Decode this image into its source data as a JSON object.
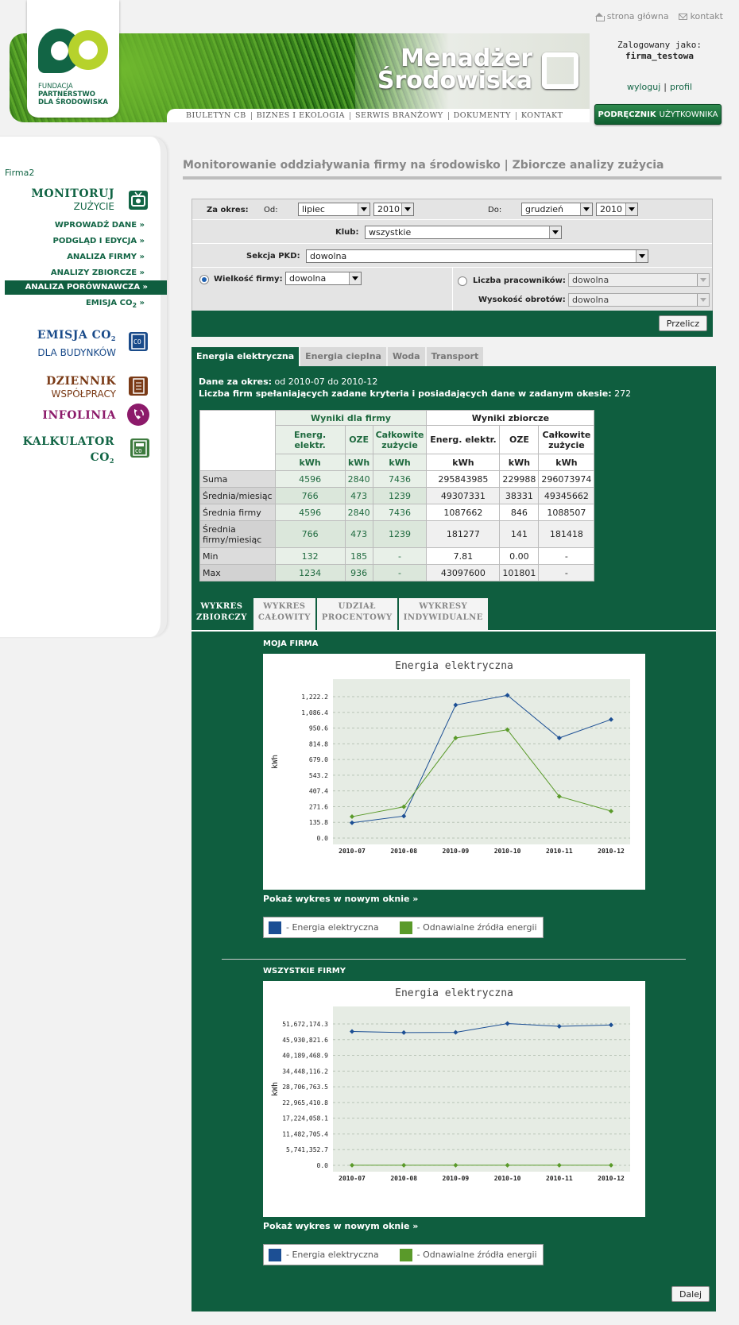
{
  "top_links": {
    "home": "strona główna",
    "contact": "kontakt"
  },
  "logo": {
    "line1": "FUNDACJA",
    "line2": "PARTNERSTWO",
    "line3": "DLA ŚRODOWISKA"
  },
  "brand": {
    "line1": "Menadżer",
    "line2": "Środowiska"
  },
  "main_nav": [
    "BIULETYN CB",
    "BIZNES I EKOLOGIA",
    "SERWIS BRANŻOWY",
    "DOKUMENTY",
    "KONTAKT"
  ],
  "login": {
    "label": "Zalogowany jako:",
    "user": "firma_testowa",
    "logout": "wyloguj",
    "separator": "|",
    "profile": "profil"
  },
  "manual_button": {
    "bold": "PODRĘCZNIK",
    "rest": "UŻYTKOWNIKA"
  },
  "sidebar": {
    "company": "Firma2",
    "monitoruj": "MONITORUJ",
    "zuzycie": "ZUŻYCIE",
    "items": [
      "WPROWADŹ DANE »",
      "PODGLĄD I EDYCJA »",
      "ANALIZA FIRMY »",
      "ANALIZY ZBIORCZE »"
    ],
    "active": "ANALIZA PORÓWNAWCZA »",
    "emisja_item": "EMISJA CO",
    "emisja_item_sub": "2",
    "emisja_item_arrow": "»",
    "emisja": "EMISJA CO",
    "emisja_sub": "2",
    "budynki": "DLA BUDYNKÓW",
    "dziennik": "DZIENNIK",
    "wspolpracy": "WSPÓŁPRACY",
    "infolinia": "INFOLINIA",
    "kalkulator": "KALKULATOR",
    "co2": "CO",
    "co2_sub": "2",
    "colors": {
      "green": "#126545",
      "blue": "#1a4b8a",
      "brown": "#7a3a16",
      "purple": "#8c1a6a"
    }
  },
  "page_title": "Monitorowanie oddziaływania firmy na środowisko | Zbiorcze analizy zużycia",
  "filter": {
    "period_label": "Za okres:",
    "from_label": "Od:",
    "from_month": "lipiec",
    "from_year": "2010",
    "to_label": "Do:",
    "to_month": "grudzień",
    "to_year": "2010",
    "club_label": "Klub:",
    "club": "wszystkie",
    "pkd_label": "Sekcja PKD:",
    "pkd": "dowolna",
    "size_label": "Wielkość firmy:",
    "size": "dowolna",
    "employees_label": "Liczba pracowników:",
    "employees": "dowolna",
    "turnover_label": "Wysokość obrotów:",
    "turnover": "dowolna",
    "recalc": "Przelicz"
  },
  "tabs": [
    "Energia elektryczna",
    "Energia cieplna",
    "Woda",
    "Transport"
  ],
  "info": {
    "period_bold": "Dane za okres:",
    "period_text": "od 2010-07 do 2010-12",
    "count_bold": "Liczba firm spełaniających zadane kryteria i posiadających dane w zadanym okesie:",
    "count": "272"
  },
  "results": {
    "firm_header": "Wyniki dla firmy",
    "all_header": "Wyniki zbiorcze",
    "col_energy": "Energ. elektr.",
    "col_oze": "OZE",
    "col_total_1": "Całkowite",
    "col_total_2": "zużycie",
    "unit": "kWh",
    "rows": [
      {
        "label": "Suma",
        "label2": "",
        "f": [
          "4596",
          "2840",
          "7436"
        ],
        "a": [
          "295843985",
          "229988",
          "296073974"
        ]
      },
      {
        "label": "Średnia/miesiąc",
        "label2": "",
        "f": [
          "766",
          "473",
          "1239"
        ],
        "a": [
          "49307331",
          "38331",
          "49345662"
        ]
      },
      {
        "label": "Średnia firmy",
        "label2": "",
        "f": [
          "4596",
          "2840",
          "7436"
        ],
        "a": [
          "1087662",
          "846",
          "1088507"
        ]
      },
      {
        "label": "Średnia",
        "label2": "firmy/miesiąc",
        "f": [
          "766",
          "473",
          "1239"
        ],
        "a": [
          "181277",
          "141",
          "181418"
        ]
      },
      {
        "label": "Min",
        "label2": "",
        "f": [
          "132",
          "185",
          "-"
        ],
        "a": [
          "7.81",
          "0.00",
          "-"
        ]
      },
      {
        "label": "Max",
        "label2": "",
        "f": [
          "1234",
          "936",
          "-"
        ],
        "a": [
          "43097600",
          "101801",
          "-"
        ]
      }
    ]
  },
  "chart_tabs": [
    {
      "l1": "WYKRES",
      "l2": "ZBIORCZY"
    },
    {
      "l1": "WYKRES",
      "l2": "CAŁOWITY"
    },
    {
      "l1": "UDZIAŁ",
      "l2": "PROCENTOWY"
    },
    {
      "l1": "WYKRESY",
      "l2": "INDYWIDUALNE"
    }
  ],
  "sections": {
    "mine": "MOJA FIRMA",
    "all": "WSZYSTKIE FIRMY",
    "show_link": "Pokaż wykres w nowym oknie »",
    "legend_energy": "- Energia elektryczna",
    "legend_oze": "- Odnawialne źródła energii",
    "next": "Dalej"
  },
  "chart_data": [
    {
      "type": "line",
      "title": "Energia elektryczna",
      "ylabel": "kWh",
      "xlabel": "",
      "categories": [
        "2010-07",
        "2010-08",
        "2010-09",
        "2010-10",
        "2010-11",
        "2010-12"
      ],
      "yticks": [
        "0.0",
        "135.8",
        "271.6",
        "407.4",
        "543.2",
        "679.0",
        "814.8",
        "950.6",
        "1,086.4",
        "1,222.2"
      ],
      "ylim": [
        0,
        1222.2
      ],
      "grid": true,
      "series": [
        {
          "name": "Energia elektryczna",
          "color": "#1c4f94",
          "values": [
            132,
            190,
            1150,
            1234,
            865,
            1025
          ]
        },
        {
          "name": "Odnawialne źródła energii",
          "color": "#5a9a2a",
          "values": [
            185,
            270,
            865,
            936,
            360,
            233
          ]
        }
      ]
    },
    {
      "type": "line",
      "title": "Energia elektryczna",
      "ylabel": "kWh",
      "xlabel": "",
      "categories": [
        "2010-07",
        "2010-08",
        "2010-09",
        "2010-10",
        "2010-11",
        "2010-12"
      ],
      "yticks": [
        "0.0",
        "5,741,352.7",
        "11,482,705.4",
        "17,224,058.1",
        "22,965,410.8",
        "28,706,763.5",
        "34,448,116.2",
        "40,189,468.9",
        "45,930,821.6",
        "51,672,174.3"
      ],
      "ylim": [
        0,
        51672174.3
      ],
      "grid": true,
      "series": [
        {
          "name": "Energia elektryczna",
          "color": "#1c4f94",
          "values": [
            48900000,
            48500000,
            48600000,
            51800000,
            50800000,
            51300000
          ]
        },
        {
          "name": "Odnawialne źródła energii",
          "color": "#5a9a2a",
          "values": [
            38000,
            38500,
            38200,
            38600,
            38300,
            38400
          ]
        }
      ]
    }
  ]
}
